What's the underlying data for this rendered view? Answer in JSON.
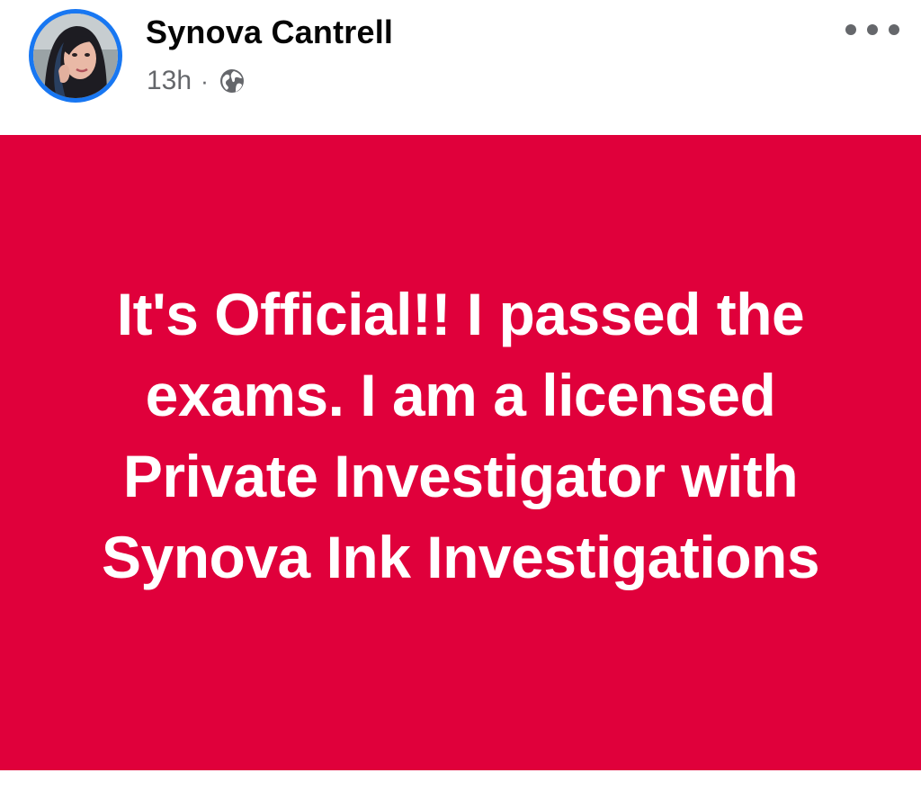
{
  "post": {
    "author_name": "Synova Cantrell",
    "timestamp": "13h",
    "separator": "·",
    "privacy_icon": "globe-icon",
    "more_icon": "more-options-icon",
    "avatar_ring_color": "#1877f2",
    "background_color": "#e0003b",
    "status_text": "It's Official!! I passed the exams. I am a licensed Private Investigator with Synova Ink Investigations"
  }
}
